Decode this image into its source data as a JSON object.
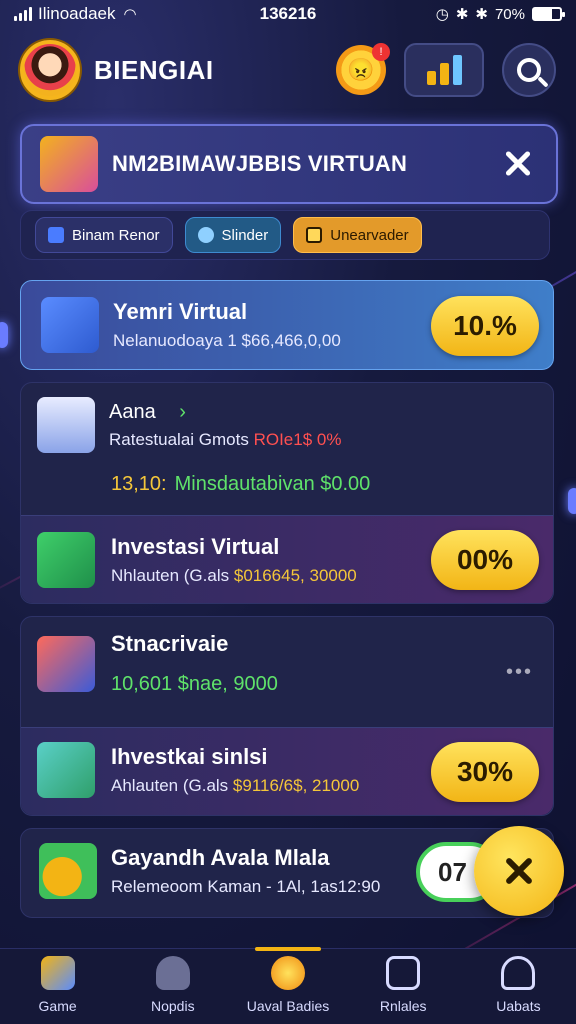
{
  "status_bar": {
    "carrier": "Ilinoadaek",
    "time": "136216",
    "battery": "70%",
    "battery_level": 0.7
  },
  "header": {
    "title": "BIENGIAI",
    "icons": [
      "avatar",
      "sun-mascot-icon",
      "chart-icon",
      "search-icon"
    ],
    "notification_dot": "!"
  },
  "banner": {
    "text": "NM2BIMAWJBBIS VIRTUAN"
  },
  "chips": [
    {
      "label": "Binam Renor",
      "icon": "card-icon"
    },
    {
      "label": "Slinder",
      "icon": "slider-icon"
    },
    {
      "label": "Unearvader",
      "icon": "lock-icon"
    }
  ],
  "cards": [
    {
      "title": "Yemri Virtual",
      "subtitle": "Nelanuodoaya 1 $66,466,0,00",
      "badge": "10.%"
    },
    {
      "title": "Aana",
      "title_suffix": "›",
      "subtitle_a": "Ratestualai Gmots",
      "subtitle_b": "ROIe1$ 0%",
      "line_a": "13,10:",
      "line_b": "Minsdautabivan $0.00"
    },
    {
      "title": "Investasi Virtual",
      "subtitle_a": "Nhlauten (G.als",
      "subtitle_b": "$016645, 30000",
      "badge": "00%"
    },
    {
      "title": "Stnacrivaie",
      "line": "10,601 $nae, 9000",
      "more": "•••"
    },
    {
      "title": "Ihvestkai sinlsi",
      "subtitle_a": "Ahlauten (G.als",
      "subtitle_b": "$9116/6$, 21000",
      "badge": "30%"
    },
    {
      "title": "Gayandh Avala Mlala",
      "subtitle": "Relemeoom Kaman - 1Al, 1as12:90",
      "toggle_value": "07"
    }
  ],
  "bottom_nav": [
    {
      "label": "Game",
      "icon": "game-icon",
      "active": false
    },
    {
      "label": "Nopdis",
      "icon": "person-icon",
      "active": false
    },
    {
      "label": "Uaval Badies",
      "icon": "star-icon",
      "active": true
    },
    {
      "label": "Rnlales",
      "icon": "smile-icon",
      "active": false
    },
    {
      "label": "Uabats",
      "icon": "profile-icon",
      "active": false
    }
  ],
  "colors": {
    "accent": "#f3b414",
    "background": "#161a3e",
    "highlight_blue": "#3f7ec9",
    "positive": "#5fe26a",
    "negative": "#ff5050"
  }
}
